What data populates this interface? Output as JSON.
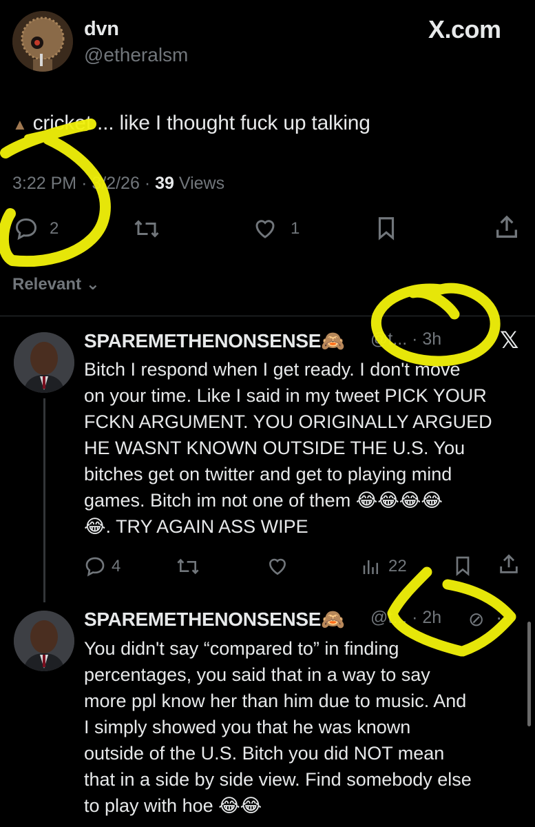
{
  "main_tweet": {
    "display_name": "dvn",
    "handle": "@etheralsm",
    "brand": "X.com",
    "text": "cricket ... like I thought fuck up talking",
    "time": "3:22 PM",
    "date": "3/2/26",
    "separator": "·",
    "views_count": "39",
    "views_label": "Views",
    "replies": "2",
    "likes": "1"
  },
  "sort": {
    "label": "Relevant"
  },
  "replies": [
    {
      "display_name": "SPAREMETHENONSENSE🙈",
      "handle": "@t...",
      "time": "· 3h",
      "text": "Bitch I respond when I get ready. I don't move\non your time. Like I said in my tweet PICK YOUR\nFCKN ARGUMENT. YOU ORIGINALLY ARGUED\nHE WASNT KNOWN OUTSIDE THE U.S.  You\nbitches get on twitter and get to playing mind\ngames. Bitch im not one of them 😂😂😂😂\n😂. TRY AGAIN ASS WIPE",
      "replies": "4",
      "views": "22"
    },
    {
      "display_name": "SPAREMETHENONSENSE🙈",
      "handle": "@t...",
      "time": "· 2h",
      "text": "You didn't say “compared to” in finding\npercentages, you said that in a way to say\nmore ppl know her than him due to music. And\nI simply showed you that he was known\noutside of the U.S. Bitch you did NOT mean\nthat in a side by side view. Find somebody else\nto play with hoe 😂😂"
    }
  ],
  "colors": {
    "background": "#000000",
    "text": "#e7e9ea",
    "muted": "#71767b",
    "annotation": "#f2f20a"
  }
}
